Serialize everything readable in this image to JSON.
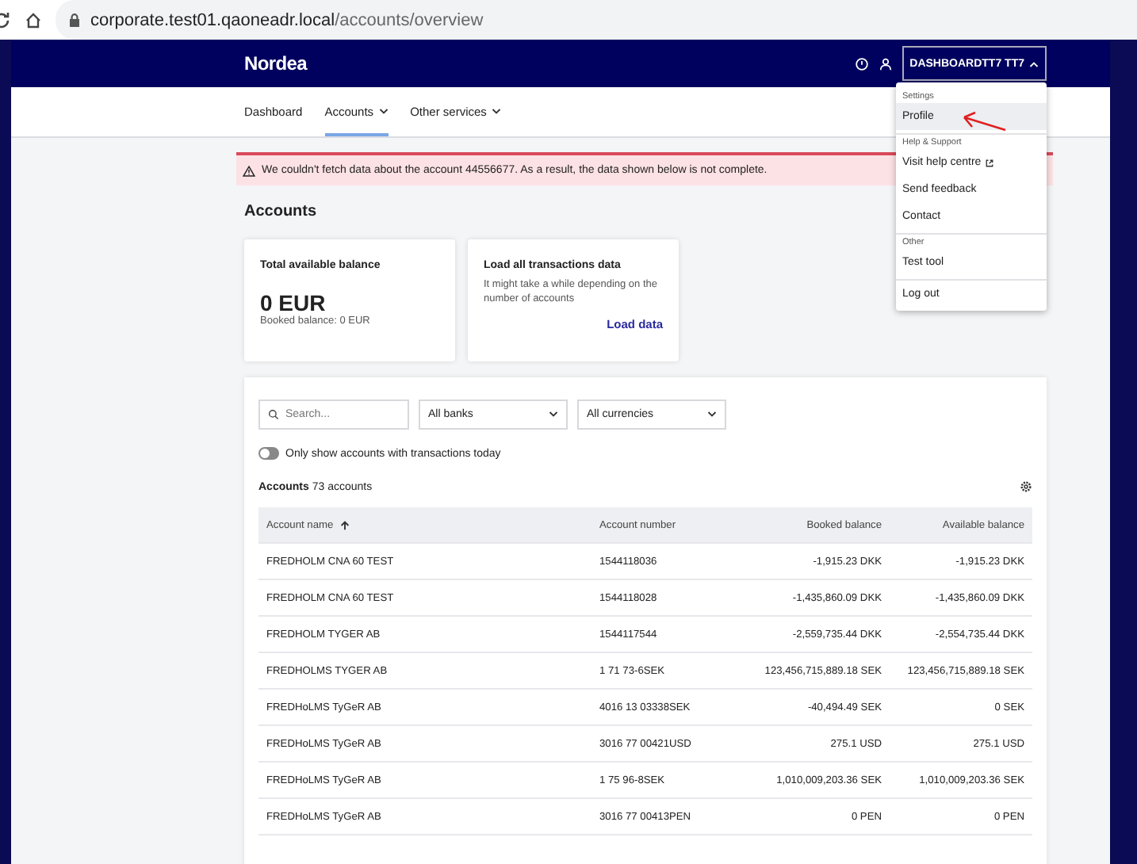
{
  "browser": {
    "url_host": "corporate.test01.qaoneadr.local",
    "url_path": "/accounts/overview"
  },
  "header": {
    "logo": "Nordea",
    "user_button": "DASHBOARDTT7 TT7",
    "menu_open": true
  },
  "nav": [
    {
      "label": "Dashboard",
      "selected": false,
      "dropdown": false
    },
    {
      "label": "Accounts",
      "selected": true,
      "dropdown": true
    },
    {
      "label": "Other services",
      "selected": false,
      "dropdown": true
    }
  ],
  "alert": {
    "message": "We couldn't fetch data about the account 44556677. As a result, the data shown below is not complete."
  },
  "page_title": "Accounts",
  "balance_card": {
    "title": "Total available balance",
    "amount": "0 EUR",
    "booked": "Booked balance: 0 EUR"
  },
  "load_card": {
    "title": "Load all transactions data",
    "text": "It might take a while depending on the number of accounts",
    "link": "Load data"
  },
  "filters": {
    "search_placeholder": "Search...",
    "bank": "All banks",
    "currency": "All currencies"
  },
  "toggle": {
    "label": "Only show accounts with transactions today",
    "on": false
  },
  "accounts_heading": {
    "title": "Accounts",
    "count": "73 accounts"
  },
  "table": {
    "columns": [
      {
        "label": "Account name",
        "sorted": true
      },
      {
        "label": "Account number",
        "sorted": false
      },
      {
        "label": "Booked balance",
        "sorted": false
      },
      {
        "label": "Available balance",
        "sorted": false
      }
    ],
    "rows": [
      [
        "FREDHOLM CNA 60 TEST",
        "1544118036",
        "-1,915.23 DKK",
        "-1,915.23 DKK"
      ],
      [
        "FREDHOLM CNA 60 TEST",
        "1544118028",
        "-1,435,860.09 DKK",
        "-1,435,860.09 DKK"
      ],
      [
        "FREDHOLM TYGER AB",
        "1544117544",
        "-2,559,735.44 DKK",
        "-2,554,735.44 DKK"
      ],
      [
        "FREDHOLMS TYGER AB",
        "1 71 73-6SEK",
        "123,456,715,889.18 SEK",
        "123,456,715,889.18 SEK"
      ],
      [
        "FREDHoLMS TyGeR AB",
        "4016 13 03338SEK",
        "-40,494.49 SEK",
        "0 SEK"
      ],
      [
        "FREDHoLMS TyGeR AB",
        "3016 77 00421USD",
        "275.1 USD",
        "275.1 USD"
      ],
      [
        "FREDHoLMS TyGeR AB",
        "1 75 96-8SEK",
        "1,010,009,203.36 SEK",
        "1,010,009,203.36 SEK"
      ],
      [
        "FREDHoLMS TyGeR AB",
        "3016 77 00413PEN",
        "0 PEN",
        "0 PEN"
      ]
    ]
  },
  "menu": [
    {
      "heading": "Settings",
      "items": [
        {
          "label": "Profile",
          "selected": true,
          "external": false
        }
      ]
    },
    {
      "heading": "Help & Support",
      "items": [
        {
          "label": "Visit help centre",
          "selected": false,
          "external": true
        },
        {
          "label": "Send feedback",
          "selected": false,
          "external": false
        },
        {
          "label": "Contact",
          "selected": false,
          "external": false
        }
      ]
    },
    {
      "heading": "Other",
      "items": [
        {
          "label": "Test tool",
          "selected": false,
          "external": false
        }
      ]
    },
    {
      "items": [
        {
          "label": "Log out",
          "selected": false,
          "external": false
        }
      ]
    }
  ]
}
